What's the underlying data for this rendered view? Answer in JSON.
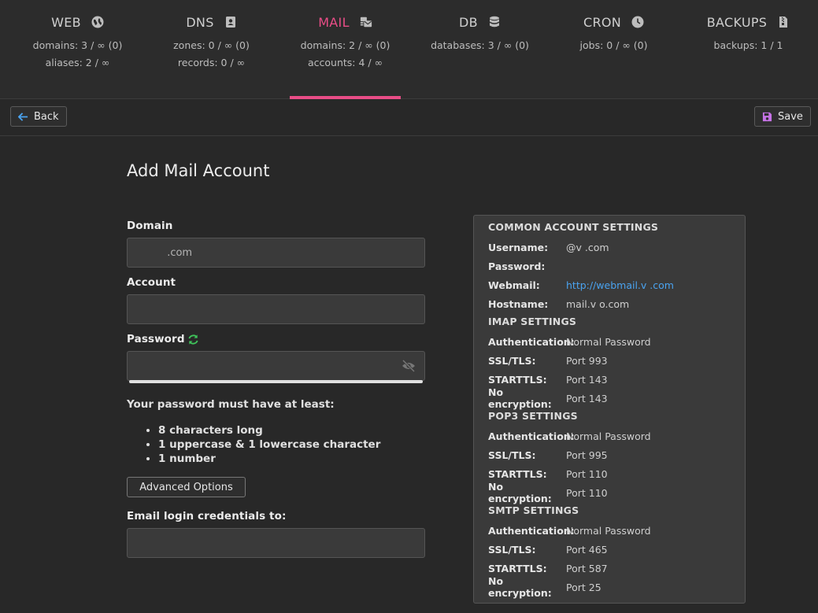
{
  "nav": [
    {
      "label": "WEB",
      "icon": "globe-icon",
      "stats": [
        "domains: 3 / ∞ (0)",
        "aliases: 2 / ∞"
      ]
    },
    {
      "label": "DNS",
      "icon": "address-book-icon",
      "stats": [
        "zones: 0 / ∞ (0)",
        "records: 0 / ∞"
      ]
    },
    {
      "label": "MAIL",
      "icon": "mail-bulk-icon",
      "stats": [
        "domains: 2 / ∞ (0)",
        "accounts: 4 / ∞"
      ]
    },
    {
      "label": "DB",
      "icon": "database-icon",
      "stats": [
        "databases: 3 / ∞ (0)"
      ]
    },
    {
      "label": "CRON",
      "icon": "clock-icon",
      "stats": [
        "jobs: 0 / ∞ (0)"
      ]
    },
    {
      "label": "BACKUPS",
      "icon": "file-archive-icon",
      "stats": [
        "backups: 1 / 1"
      ]
    }
  ],
  "active_tab": "MAIL",
  "accent_color": "#e94d87",
  "toolbar": {
    "back_label": "Back",
    "save_label": "Save"
  },
  "form": {
    "title": "Add Mail Account",
    "domain_label": "Domain",
    "domain_value": "         .com",
    "account_label": "Account",
    "account_value": "",
    "password_label": "Password",
    "password_value": "",
    "requirements_title": "Your password must have at least:",
    "requirements": [
      "8 characters long",
      "1 uppercase & 1 lowercase character",
      "1 number"
    ],
    "advanced_label": "Advanced Options",
    "email_label": "Email login credentials to:",
    "email_value": ""
  },
  "settings": {
    "common_title": "COMMON ACCOUNT SETTINGS",
    "username_key": "Username:",
    "username_value": "@v          .com",
    "password_key": "Password:",
    "password_value": "",
    "webmail_key": "Webmail:",
    "webmail_value": "http://webmail.v           .com",
    "hostname_key": "Hostname:",
    "hostname_value": "mail.v           o.com",
    "imap_title": "IMAP SETTINGS",
    "imap": [
      {
        "k": "Authentication:",
        "v": "Normal Password"
      },
      {
        "k": "SSL/TLS:",
        "v": "Port 993"
      },
      {
        "k": "STARTTLS:",
        "v": "Port 143"
      },
      {
        "k": "No encryption:",
        "v": "Port 143"
      }
    ],
    "pop3_title": "POP3 SETTINGS",
    "pop3": [
      {
        "k": "Authentication:",
        "v": "Normal Password"
      },
      {
        "k": "SSL/TLS:",
        "v": "Port 995"
      },
      {
        "k": "STARTTLS:",
        "v": "Port 110"
      },
      {
        "k": "No encryption:",
        "v": "Port 110"
      }
    ],
    "smtp_title": "SMTP SETTINGS",
    "smtp": [
      {
        "k": "Authentication:",
        "v": "Normal Password"
      },
      {
        "k": "SSL/TLS:",
        "v": "Port 465"
      },
      {
        "k": "STARTTLS:",
        "v": "Port 587"
      },
      {
        "k": "No encryption:",
        "v": "Port 25"
      }
    ]
  }
}
